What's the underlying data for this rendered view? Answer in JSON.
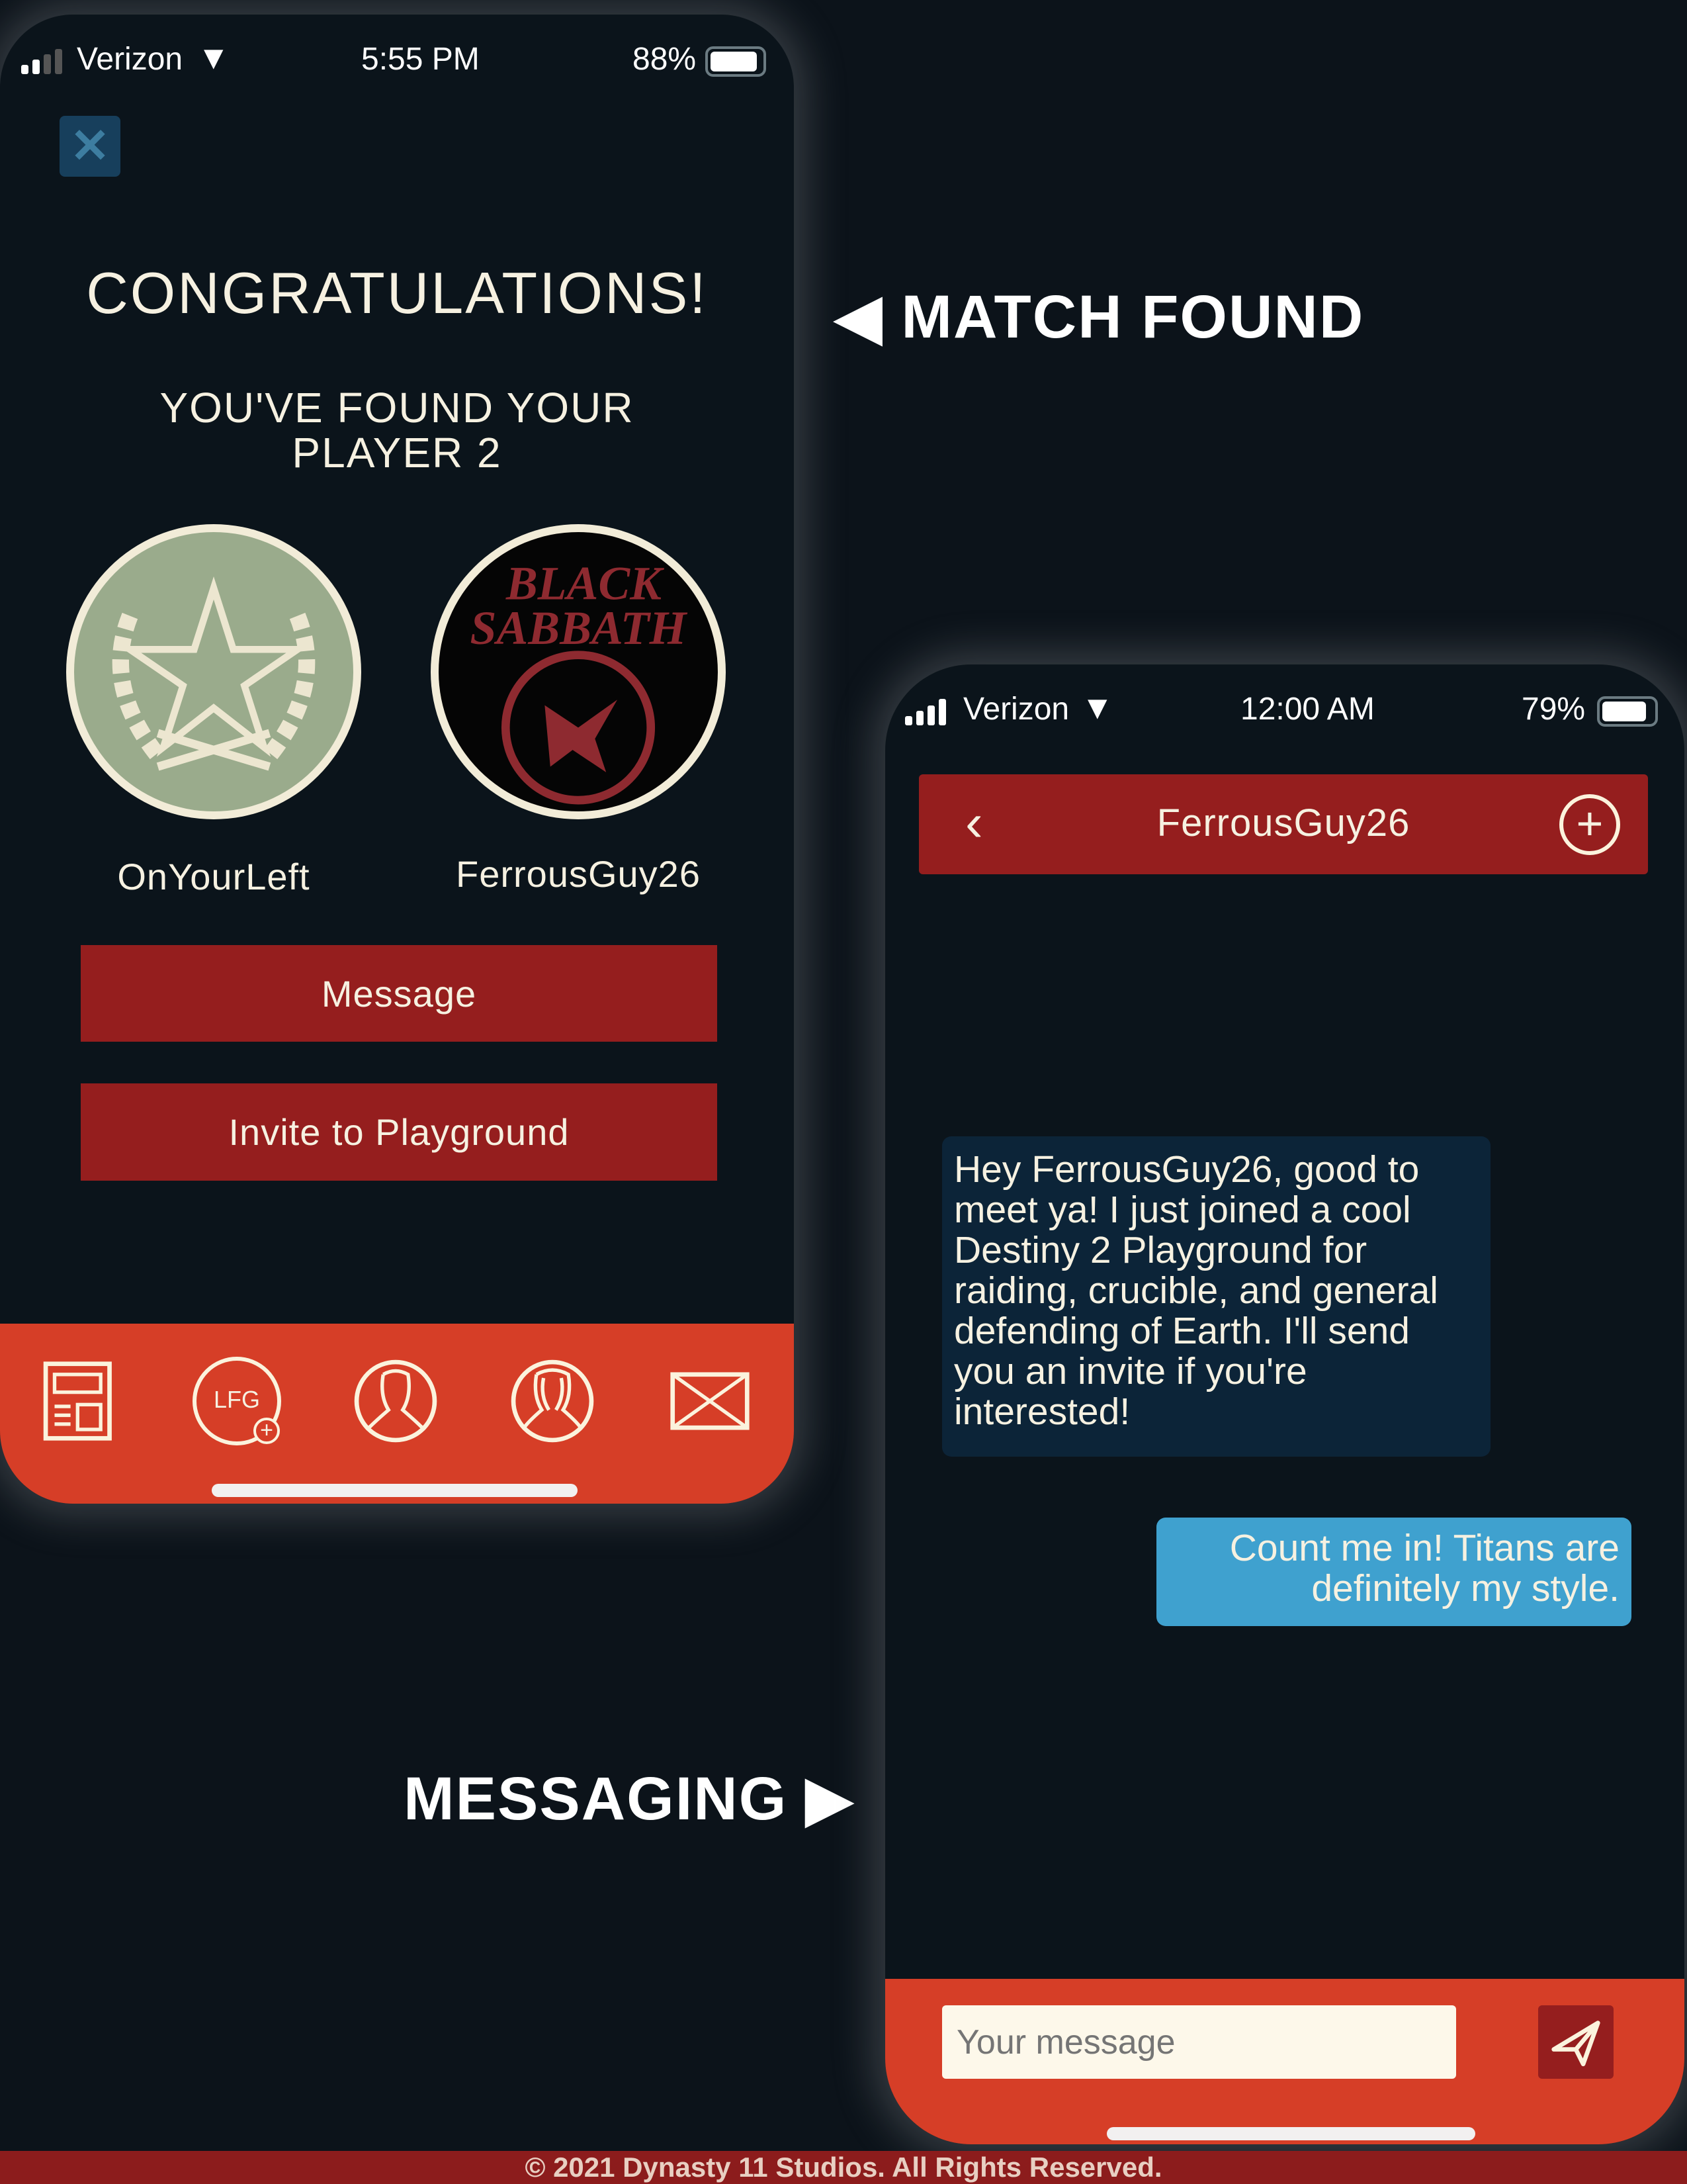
{
  "match_screen": {
    "status": {
      "carrier": "Verizon",
      "time": "5:55 PM",
      "battery": "88%"
    },
    "title": "CONGRATULATIONS!",
    "subtitle_line1": "YOU'VE FOUND YOUR",
    "subtitle_line2": "PLAYER 2",
    "players": [
      {
        "name": "OnYourLeft",
        "avatar": "star-laurel-emblem"
      },
      {
        "name": "FerrousGuy26",
        "avatar": "band-logo",
        "logo_text_1": "BLACK",
        "logo_text_2": "SABBATH"
      }
    ],
    "message_button": "Message",
    "invite_button": "Invite to Playground",
    "nav": [
      {
        "icon": "news-icon"
      },
      {
        "icon": "lfg-icon",
        "label": "LFG"
      },
      {
        "icon": "player-icon"
      },
      {
        "icon": "players-icon"
      },
      {
        "icon": "mail-icon"
      }
    ]
  },
  "callouts": {
    "match_found": "MATCH FOUND",
    "messaging": "MESSAGING"
  },
  "chat_screen": {
    "status": {
      "carrier": "Verizon",
      "time": "12:00 AM",
      "battery": "79%"
    },
    "header_title": "FerrousGuy26",
    "messages": [
      {
        "direction": "received",
        "text": "Hey FerrousGuy26, good to meet ya! I just joined a cool Destiny 2 Playground for raiding, crucible, and general defending of Earth. I'll send you an invite if you're interested!"
      },
      {
        "direction": "sent",
        "text": "Count me in! Titans are definitely my style."
      }
    ],
    "input_placeholder": "Your message"
  },
  "footer": "© 2021 Dynasty 11 Studios. All Rights Reserved.",
  "colors": {
    "accent_red": "#951e1e",
    "nav_orange": "#d63e27",
    "sent_bubble": "#3fa1cf",
    "received_bubble": "#0c2438"
  }
}
